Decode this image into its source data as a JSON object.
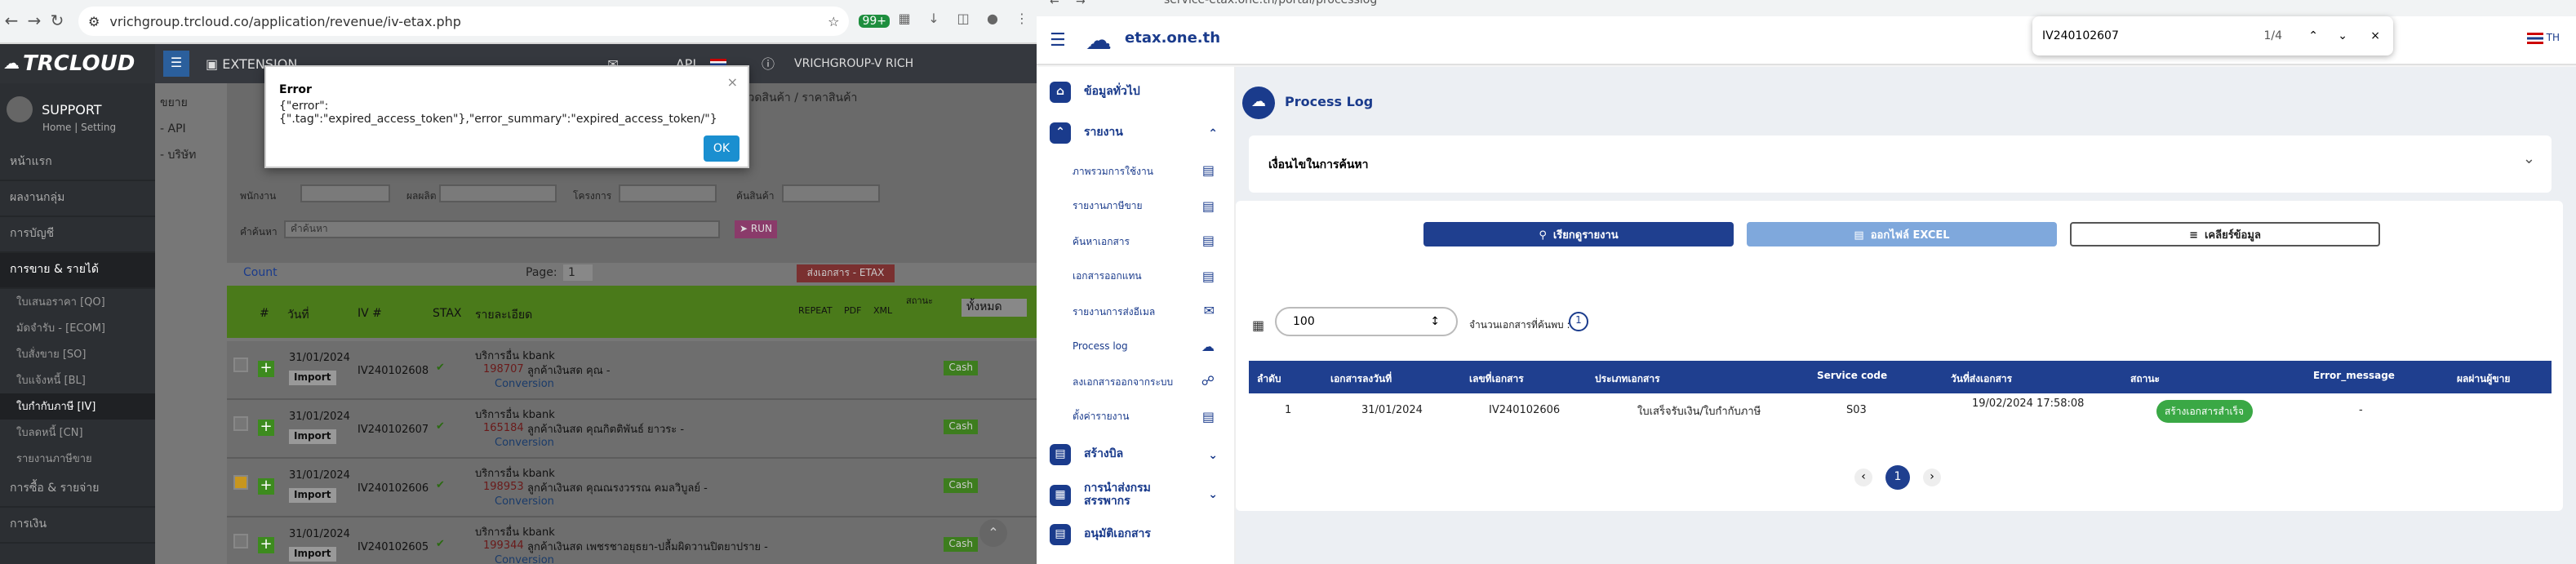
{
  "left_browser": {
    "url": "vrichgroup.trcloud.co/application/revenue/iv-etax.php",
    "badge": "99+"
  },
  "trcloud": {
    "logo": "TRCLOUD",
    "menu_extension": "EXTENSION",
    "api": "API",
    "company": "VRICHGROUP-V RICH",
    "user": "SUPPORT",
    "user_links": "Home  |  Setting",
    "side_items": [
      "หน้าแรก",
      "ผลงานกลุ่ม",
      "การบัญชี",
      "การขาย & รายได้"
    ],
    "side_subs": [
      "ใบเสนอราคา [QO]",
      "มัดจำรับ - [ECOM]",
      "ใบสั่งขาย [SO]",
      "ใบแจ้งหนี้ [BL]",
      "ใบกำกับภาษี [IV]",
      "ใบลดหนี้ [CN]",
      "รายงานภาษีขาย"
    ],
    "side_tail": [
      "การซื้อ & รายจ่าย",
      "การเงิน"
    ],
    "left_menu_bits": [
      "ขยาย",
      "- API",
      "- บริษัท"
    ],
    "top_right_label": "หมวดสินค้า / ราคาสินค้า",
    "filters": {
      "contact": "พนักงาน",
      "seller": "ผลผลิต",
      "project": "โครงการ",
      "search_product": "ค้นสินค้า",
      "keyword": "คำค้นหา",
      "keyword_ph": "คำค้นหา",
      "run": "RUN"
    },
    "count_label": "Count",
    "page_label": "Page:",
    "page_value": "1",
    "etax_button": "ส่งเอกสาร - ETAX",
    "columns": [
      "#",
      "วันที่",
      "IV #",
      "STAX",
      "รายละเอียด",
      "REPEAT",
      "PDF",
      "XML",
      "สถานะ"
    ],
    "filter_select": "ทั้งหมด",
    "rows": [
      {
        "date": "31/01/2024",
        "iv": "IV240102608",
        "service": "บริการอื่น kbank",
        "ref": "198707",
        "customer": "ลูกค้าเงินสด คุณ -",
        "conv": "Conversion",
        "import": "Import",
        "cash": "Cash"
      },
      {
        "date": "31/01/2024",
        "iv": "IV240102607",
        "service": "บริการอื่น kbank",
        "ref": "165184",
        "customer": "ลูกค้าเงินสด คุณกิตติพันธ์ ยาวระ -",
        "conv": "Conversion",
        "import": "Import",
        "cash": "Cash"
      },
      {
        "date": "31/01/2024",
        "iv": "IV240102606",
        "service": "บริการอื่น kbank",
        "ref": "198953",
        "customer": "ลูกค้าเงินสด คุณณรงวรรณ คมลวิบูลย์ -",
        "conv": "Conversion",
        "import": "Import",
        "cash": "Cash"
      },
      {
        "date": "31/01/2024",
        "iv": "IV240102605",
        "service": "บริการอื่น kbank",
        "ref": "199344",
        "customer": "ลูกค้าเงินสด เพชรชาอยุธยา-ปลื้มผิดวานปิตยาปราย -",
        "conv": "Conversion",
        "import": "Import",
        "cash": "Cash"
      }
    ],
    "modal": {
      "title": "Error",
      "message": "{\"error\":{\".tag\":\"expired_access_token\"},\"error_summary\":\"expired_access_token/\"}",
      "ok": "OK"
    }
  },
  "right_browser": {
    "url": "service-etax.one.th/portal/processlog"
  },
  "etax": {
    "brand": "etax.one.th",
    "lang": "TH",
    "find": {
      "query": "IV240102607",
      "count": "1/4"
    },
    "side": [
      {
        "label": "ข้อมูลทั่วไป",
        "kind": "group"
      },
      {
        "label": "รายงาน",
        "kind": "group"
      },
      {
        "label": "ภาพรวมการใช้งาน",
        "kind": "sub"
      },
      {
        "label": "รายงานภาษีขาย",
        "kind": "sub"
      },
      {
        "label": "ค้นหาเอกสาร",
        "kind": "sub"
      },
      {
        "label": "เอกสารออกแทน",
        "kind": "sub"
      },
      {
        "label": "รายงานการส่งอีเมล",
        "kind": "sub"
      },
      {
        "label": "Process log",
        "kind": "sub"
      },
      {
        "label": "ลงเอกสารออกจากระบบ",
        "kind": "sub"
      },
      {
        "label": "ตั้งค่ารายงาน",
        "kind": "sub"
      },
      {
        "label": "สร้างบิล",
        "kind": "group"
      },
      {
        "label": "การนำส่งกรมสรรพากร",
        "kind": "group"
      },
      {
        "label": "อนุมัติเอกสาร",
        "kind": "group"
      }
    ],
    "title": "Process Log",
    "search_cond": "เงื่อนไขในการค้นหา",
    "btn_report": "เรียกดูรายงาน",
    "btn_excel": "ออกไฟล์ EXCEL",
    "btn_clear": "เคลียร์ข้อมูล",
    "page_size": "100",
    "doc_count_label": "จำนวนเอกสารที่ค้นพบ :",
    "doc_count": "1",
    "columns": [
      "ลำดับ",
      "เอกสารลงวันที่",
      "เลขที่เอกสาร",
      "ประเภทเอกสาร",
      "Service code",
      "วันที่ส่งเอกสาร",
      "สถานะ",
      "Error_message",
      "ผลผ่านผู้ขาย"
    ],
    "row": {
      "no": "1",
      "doc_date": "31/01/2024",
      "doc_no": "IV240102606",
      "doc_type": "ใบเสร็จรับเงิน/ใบกำกับภาษี",
      "service_code": "S03",
      "sent": "19/02/2024 17:58:08",
      "status": "สร้างเอกสารสำเร็จ",
      "error": "-"
    },
    "page": "1",
    "colors": {
      "primary": "#1f3f8f",
      "success": "#3aa845",
      "excel": "#7fa8dc"
    }
  }
}
